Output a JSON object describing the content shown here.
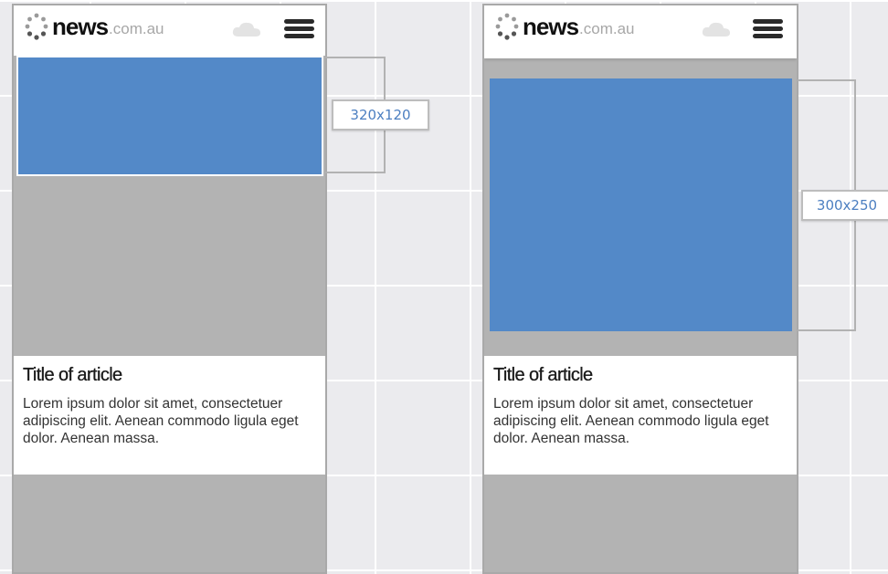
{
  "phones": [
    {
      "brand": "news",
      "domain": ".com.au",
      "article": {
        "title": "Title of article",
        "body": "Lorem ipsum dolor sit amet, consectetuer adipiscing elit. Aenean commodo ligula eget dolor. Aenean massa."
      }
    },
    {
      "brand": "news",
      "domain": ".com.au",
      "article": {
        "title": "Title of article",
        "body": "Lorem ipsum dolor sit amet, consectetuer adipiscing elit. Aenean commodo ligula eget dolor. Aenean massa."
      }
    }
  ],
  "ad_sizes": {
    "banner": "320x120",
    "mrec": "300x250"
  },
  "icons": {
    "logo": "news-dots-icon",
    "weather": "cloud-icon",
    "menu": "hamburger-menu-icon"
  },
  "colors": {
    "ad_slot": "#5389c8",
    "placeholder": "#b3b3b3",
    "label_text": "#4c7fc1"
  }
}
